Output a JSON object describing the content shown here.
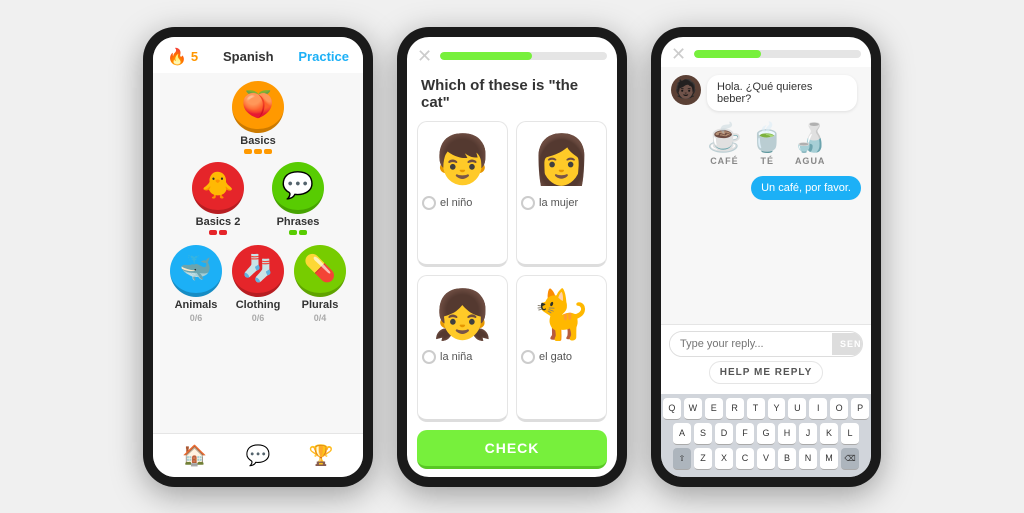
{
  "phone1": {
    "streak": "5",
    "language": "Spanish",
    "practice_label": "Practice",
    "skills": [
      {
        "id": "basics",
        "label": "Basics",
        "color": "#ff9900",
        "emoji": "🍑",
        "pips": 3,
        "pip_color": "#ff9900"
      },
      {
        "id": "basics2",
        "label": "Basics 2",
        "color": "#e5252a",
        "emoji": "🐥",
        "pips": 2,
        "pip_color": "#e5252a"
      },
      {
        "id": "phrases",
        "label": "Phrases",
        "color": "#58cc02",
        "emoji": "💬",
        "pips": 2,
        "pip_color": "#58cc02"
      },
      {
        "id": "animals",
        "label": "Animals",
        "color": "#1cb0f6",
        "emoji": "🐳",
        "progress": "0/6",
        "pips": 0
      },
      {
        "id": "clothing",
        "label": "Clothing",
        "color": "#e5252a",
        "emoji": "🧦",
        "progress": "0/6",
        "pips": 0
      },
      {
        "id": "plurals",
        "label": "Plurals",
        "color": "#77cc00",
        "emoji": "💊",
        "progress": "0/4",
        "pips": 0
      }
    ]
  },
  "phone2": {
    "progress_pct": 55,
    "question": "Which of these is \"the cat\"",
    "options": [
      {
        "id": "nino",
        "emoji": "👦",
        "label": "el niño"
      },
      {
        "id": "mujer",
        "emoji": "👩",
        "label": "la mujer"
      },
      {
        "id": "nina",
        "emoji": "👧",
        "label": "la niña"
      },
      {
        "id": "gato",
        "emoji": "🐈",
        "label": "el gato"
      }
    ],
    "check_label": "CHECK"
  },
  "phone3": {
    "progress_pct": 40,
    "bot_message": "Hola. ¿Qué quieres beber?",
    "drinks": [
      {
        "emoji": "☕",
        "label": "CAFÉ"
      },
      {
        "emoji": "🍵",
        "label": "TÉ"
      },
      {
        "emoji": "🍶",
        "label": "AGUA"
      }
    ],
    "user_reply": "Un café, por favor.",
    "reply_placeholder": "Type your reply...",
    "send_label": "SEND",
    "help_label": "HELP ME REPLY",
    "keyboard_rows": [
      [
        "Q",
        "W",
        "E",
        "R",
        "T",
        "Y",
        "U",
        "I",
        "O",
        "P"
      ],
      [
        "A",
        "S",
        "D",
        "F",
        "G",
        "H",
        "J",
        "K",
        "L"
      ],
      [
        "⇧",
        "Z",
        "X",
        "C",
        "V",
        "B",
        "N",
        "M",
        "⌫"
      ]
    ]
  }
}
